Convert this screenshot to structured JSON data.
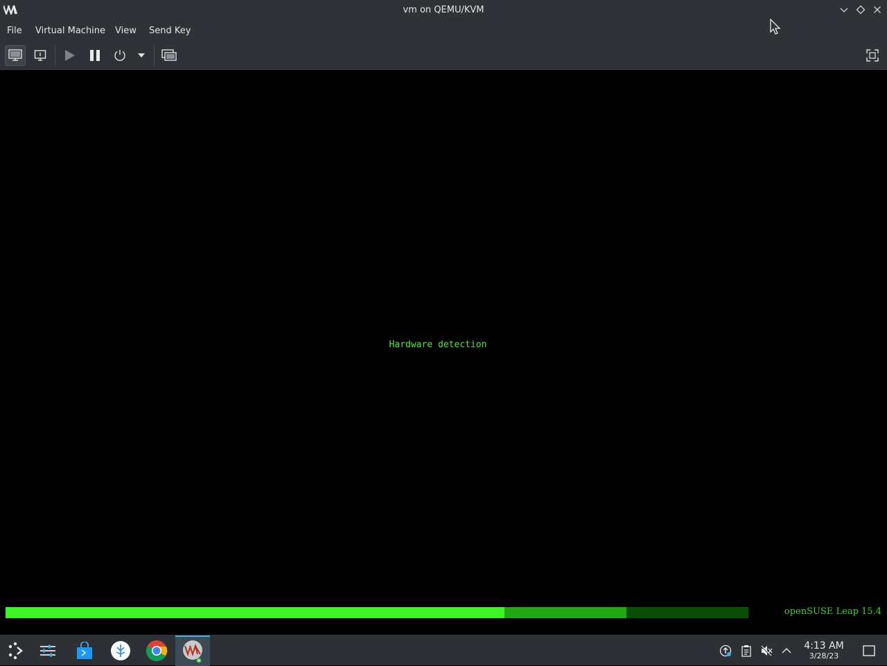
{
  "window": {
    "title": "vm on QEMU/KVM",
    "logo_text": "VM"
  },
  "menu": {
    "items": [
      {
        "id": "file",
        "label": "File"
      },
      {
        "id": "virtual-machine",
        "label": "Virtual Machine"
      },
      {
        "id": "view",
        "label": "View"
      },
      {
        "id": "send-key",
        "label": "Send Key"
      }
    ]
  },
  "toolbar": {
    "buttons": [
      "console-view-icon",
      "details-info-icon",
      "run-play-icon",
      "pause-icon",
      "power-icon",
      "chevron-down-icon",
      "snapshots-icon",
      "fullscreen-icon"
    ],
    "active": "console-view-icon"
  },
  "console": {
    "message": "Hardware detection",
    "progress": 0.672,
    "progress_secondary": 0.836,
    "os_name": "openSUSE Leap 15.4",
    "colors": {
      "text": "#4ce93a",
      "bar": "#3cf323",
      "bar_dim": "#0a4f08"
    }
  },
  "taskbar": {
    "apps": [
      "application-launcher-icon",
      "system-settings-icon",
      "discover-store-icon",
      "dolphin-icon",
      "chrome-icon",
      "virt-manager-icon"
    ],
    "tray": [
      "updates-icon",
      "clipboard-icon",
      "volume-muted-icon",
      "expand-tray-icon"
    ],
    "time": "4:13 AM",
    "date": "3/28/23"
  }
}
